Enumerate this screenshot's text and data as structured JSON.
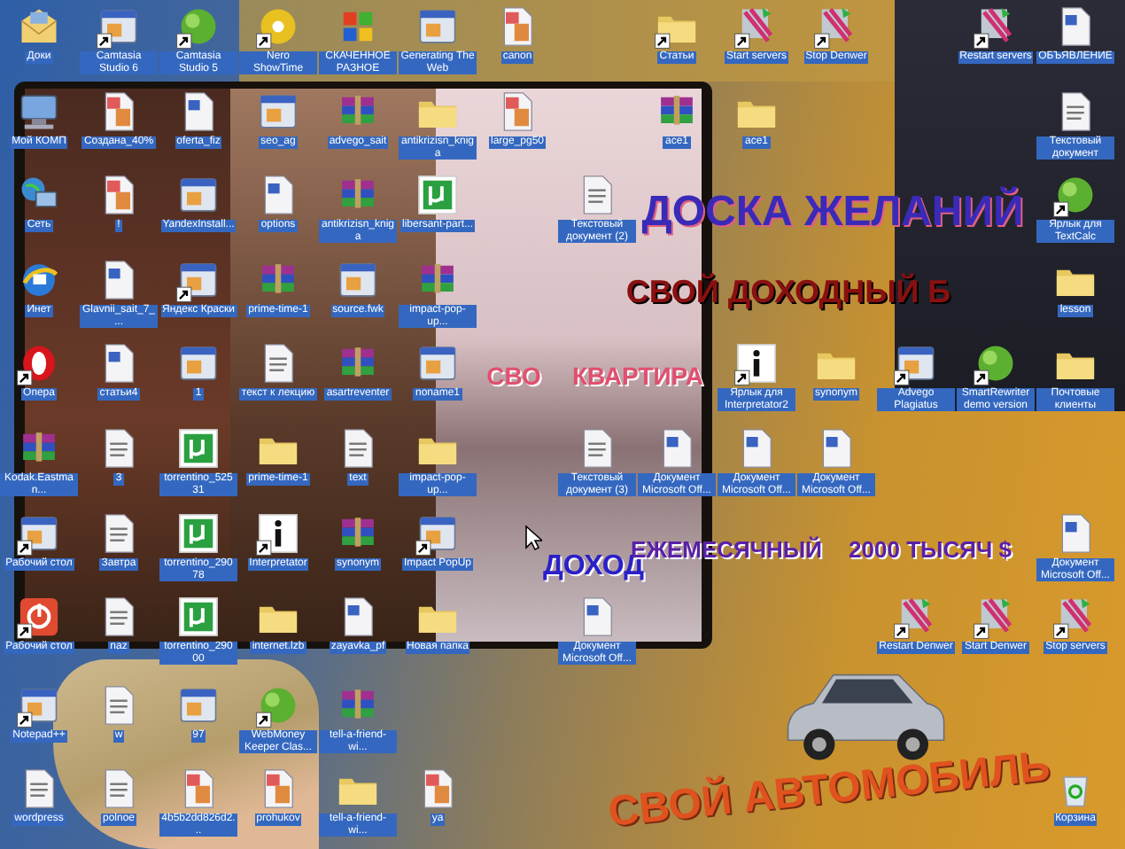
{
  "wallpaper": {
    "captions": [
      "ДОСКА ЖЕЛАНИЙ",
      "КВАРТИРА",
      "СВО",
      "СВОЙ ДОХОДНЫЙ Б",
      "ДОХОД",
      "ЕЖЕМЕСЯЧНЫЙ",
      "2000 ТЫСЯЧ $",
      "СВОЙ АВТОМОБИЛЬ"
    ]
  },
  "icons": [
    {
      "label": "Доки",
      "kind": "mail",
      "shortcut": false,
      "selected": true
    },
    {
      "label": "Camtasia Studio 6",
      "kind": "app",
      "shortcut": true,
      "selected": true
    },
    {
      "label": "Camtasia Studio 5",
      "kind": "ball",
      "shortcut": true,
      "selected": true
    },
    {
      "label": "Nero ShowTime",
      "kind": "disc",
      "shortcut": true,
      "selected": true
    },
    {
      "label": "СКАЧЕННОЕ РАЗНОЕ",
      "kind": "windows",
      "shortcut": false,
      "selected": true
    },
    {
      "label": "Generating The Web",
      "kind": "app",
      "shortcut": false,
      "selected": true
    },
    {
      "label": "canon",
      "kind": "pdf",
      "shortcut": false,
      "selected": true
    },
    {
      "label": "Статьи",
      "kind": "folder",
      "shortcut": true,
      "selected": true
    },
    {
      "label": "Start servers",
      "kind": "denwer",
      "shortcut": true,
      "selected": true
    },
    {
      "label": "Stop Denwer",
      "kind": "denwer",
      "shortcut": true,
      "selected": true
    },
    {
      "label": "Restart servers",
      "kind": "denwer",
      "shortcut": true,
      "selected": true
    },
    {
      "label": "ОБЪЯВЛЕНИЕ",
      "kind": "word",
      "shortcut": false,
      "selected": true
    },
    {
      "label": "Мой КОМП",
      "kind": "computer",
      "shortcut": false,
      "selected": true
    },
    {
      "label": "Создана_40%",
      "kind": "pdf",
      "shortcut": false,
      "selected": true
    },
    {
      "label": "oferta_fiz",
      "kind": "word",
      "shortcut": false,
      "selected": true
    },
    {
      "label": "seo_ag",
      "kind": "app",
      "shortcut": false,
      "selected": true
    },
    {
      "label": "advego_sait",
      "kind": "archive",
      "shortcut": false,
      "selected": true
    },
    {
      "label": "antikrizisn_kniga",
      "kind": "folder",
      "shortcut": false,
      "selected": true
    },
    {
      "label": "large_pg50",
      "kind": "pdf",
      "shortcut": false,
      "selected": true
    },
    {
      "label": "ace1",
      "kind": "archive",
      "shortcut": false,
      "selected": true
    },
    {
      "label": "ace1",
      "kind": "folder",
      "shortcut": false,
      "selected": true
    },
    {
      "label": "Текстовый документ",
      "kind": "text",
      "shortcut": false,
      "selected": true
    },
    {
      "label": "Сеть",
      "kind": "network",
      "shortcut": false,
      "selected": true
    },
    {
      "label": "!",
      "kind": "pdf",
      "shortcut": false,
      "selected": true
    },
    {
      "label": "YandexInstall...",
      "kind": "app",
      "shortcut": false,
      "selected": true
    },
    {
      "label": "options",
      "kind": "word",
      "shortcut": false,
      "selected": true
    },
    {
      "label": "antikrizisn_kniga",
      "kind": "archive",
      "shortcut": false,
      "selected": true
    },
    {
      "label": "libersant-part...",
      "kind": "torrent",
      "shortcut": false,
      "selected": true
    },
    {
      "label": "Текстовый документ (2)",
      "kind": "text",
      "shortcut": false,
      "selected": true
    },
    {
      "label": "Ярлык для TextCalc",
      "kind": "ball",
      "shortcut": true,
      "selected": true
    },
    {
      "label": "Инет",
      "kind": "browser",
      "shortcut": false,
      "selected": true
    },
    {
      "label": "Glavnii_sait_7_...",
      "kind": "word",
      "shortcut": false,
      "selected": true
    },
    {
      "label": "Яндекс Краски",
      "kind": "app",
      "shortcut": true,
      "selected": true
    },
    {
      "label": "prime-time-1",
      "kind": "archive",
      "shortcut": false,
      "selected": true
    },
    {
      "label": "source.fwk",
      "kind": "app",
      "shortcut": false,
      "selected": true
    },
    {
      "label": "impact-pop-up...",
      "kind": "archive",
      "shortcut": false,
      "selected": true
    },
    {
      "label": "lesson",
      "kind": "folder",
      "shortcut": false,
      "selected": true
    },
    {
      "label": "Опера",
      "kind": "opera",
      "shortcut": true,
      "selected": true
    },
    {
      "label": "статьи4",
      "kind": "word",
      "shortcut": false,
      "selected": true
    },
    {
      "label": "1",
      "kind": "app",
      "shortcut": false,
      "selected": true
    },
    {
      "label": "текст к лекцию",
      "kind": "text",
      "shortcut": false,
      "selected": true
    },
    {
      "label": "asartreventer",
      "kind": "archive",
      "shortcut": false,
      "selected": true
    },
    {
      "label": "noname1",
      "kind": "app",
      "shortcut": false,
      "selected": true
    },
    {
      "label": "Ярлык для Interpretator2",
      "kind": "info",
      "shortcut": true,
      "selected": true
    },
    {
      "label": "synonym",
      "kind": "folder",
      "shortcut": false,
      "selected": true
    },
    {
      "label": "Advego Plagiatus",
      "kind": "app",
      "shortcut": true,
      "selected": true
    },
    {
      "label": "SmartRewriter demo version",
      "kind": "ball",
      "shortcut": true,
      "selected": true
    },
    {
      "label": "Почтовые клиенты",
      "kind": "folder",
      "shortcut": false,
      "selected": true
    },
    {
      "label": "Kodak.Eastman...",
      "kind": "archive",
      "shortcut": false,
      "selected": true
    },
    {
      "label": "3",
      "kind": "text",
      "shortcut": false,
      "selected": true
    },
    {
      "label": "torrentino_52531",
      "kind": "torrent",
      "shortcut": false,
      "selected": true
    },
    {
      "label": "prime-time-1",
      "kind": "folder",
      "shortcut": false,
      "selected": true
    },
    {
      "label": "text",
      "kind": "text",
      "shortcut": false,
      "selected": true
    },
    {
      "label": "impact-pop-up...",
      "kind": "folder",
      "shortcut": false,
      "selected": true
    },
    {
      "label": "Текстовый документ (3)",
      "kind": "text",
      "shortcut": false,
      "selected": true
    },
    {
      "label": "Документ Microsoft Off...",
      "kind": "word",
      "shortcut": false,
      "selected": true
    },
    {
      "label": "Документ Microsoft Off...",
      "kind": "word",
      "shortcut": false,
      "selected": true
    },
    {
      "label": "Документ Microsoft Off...",
      "kind": "word",
      "shortcut": false,
      "selected": true
    },
    {
      "label": "Рабочий стол",
      "kind": "app",
      "shortcut": true,
      "selected": true
    },
    {
      "label": "Завтра",
      "kind": "text",
      "shortcut": false,
      "selected": true
    },
    {
      "label": "torrentino_29078",
      "kind": "torrent",
      "shortcut": false,
      "selected": true
    },
    {
      "label": "Interpretator",
      "kind": "info",
      "shortcut": true,
      "selected": true
    },
    {
      "label": "synonym",
      "kind": "archive",
      "shortcut": false,
      "selected": true
    },
    {
      "label": "Impact PopUp",
      "kind": "app",
      "shortcut": true,
      "selected": true
    },
    {
      "label": "Документ Microsoft Off...",
      "kind": "word",
      "shortcut": false,
      "selected": true
    },
    {
      "label": "Рабочий стол",
      "kind": "power",
      "shortcut": true,
      "selected": true
    },
    {
      "label": "naz",
      "kind": "text",
      "shortcut": false,
      "selected": true
    },
    {
      "label": "torrentino_29000",
      "kind": "torrent",
      "shortcut": false,
      "selected": true
    },
    {
      "label": "internet.lzb",
      "kind": "folder",
      "shortcut": false,
      "selected": true
    },
    {
      "label": "zayavka_pf",
      "kind": "word",
      "shortcut": false,
      "selected": true
    },
    {
      "label": "Новая папка",
      "kind": "folder",
      "shortcut": false,
      "selected": true
    },
    {
      "label": "Документ Microsoft Off...",
      "kind": "word",
      "shortcut": false,
      "selected": true
    },
    {
      "label": "Restart Denwer",
      "kind": "denwer",
      "shortcut": true,
      "selected": true
    },
    {
      "label": "Start Denwer",
      "kind": "denwer",
      "shortcut": true,
      "selected": true
    },
    {
      "label": "Stop servers",
      "kind": "denwer",
      "shortcut": true,
      "selected": true
    },
    {
      "label": "Notepad++",
      "kind": "app",
      "shortcut": true,
      "selected": true
    },
    {
      "label": "w",
      "kind": "text",
      "shortcut": false,
      "selected": true
    },
    {
      "label": "97",
      "kind": "app",
      "shortcut": false,
      "selected": true
    },
    {
      "label": "WebMoney Keeper Clas...",
      "kind": "ball",
      "shortcut": true,
      "selected": true
    },
    {
      "label": "tell-a-friend-wi...",
      "kind": "archive",
      "shortcut": false,
      "selected": true
    },
    {
      "label": "wordpress",
      "kind": "text",
      "shortcut": false,
      "selected": true
    },
    {
      "label": "polnoe",
      "kind": "text",
      "shortcut": false,
      "selected": true
    },
    {
      "label": "4b5b2dd826d2...",
      "kind": "pdf",
      "shortcut": false,
      "selected": true
    },
    {
      "label": "prohukov",
      "kind": "pdf",
      "shortcut": false,
      "selected": true
    },
    {
      "label": "tell-a-friend-wi...",
      "kind": "folder",
      "shortcut": false,
      "selected": true
    },
    {
      "label": "ya",
      "kind": "pdf",
      "shortcut": false,
      "selected": true
    },
    {
      "label": "Корзина",
      "kind": "trash",
      "shortcut": false,
      "selected": true
    }
  ]
}
